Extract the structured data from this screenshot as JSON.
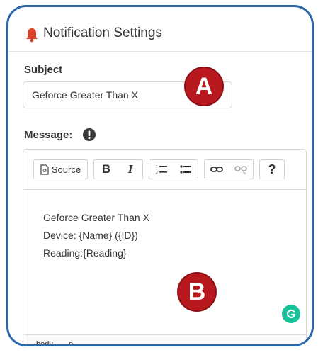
{
  "header": {
    "title": "Notification Settings",
    "icon": "bell-icon",
    "icon_color": "#d9432b"
  },
  "subject": {
    "label": "Subject",
    "value": "Geforce Greater Than X"
  },
  "message": {
    "label": "Message:",
    "info_icon": "exclamation-circle-icon"
  },
  "toolbar": {
    "source_label": "Source",
    "bold_label": "B",
    "italic_label": "I",
    "help_label": "?",
    "icons": [
      "source-icon",
      "bold-icon",
      "italic-icon",
      "numbered-list-icon",
      "bulleted-list-icon",
      "link-icon",
      "unlink-icon",
      "help-icon"
    ]
  },
  "editor": {
    "lines": [
      "Geforce Greater Than X",
      "Device: {Name} ({ID})",
      "Reading:{Reading}"
    ]
  },
  "statusbar": {
    "path": [
      "body",
      "p"
    ]
  },
  "annotations": {
    "a": "A",
    "b": "B",
    "color": "#b8191f"
  },
  "frame_color": "#2a68ad",
  "grammarly_color": "#15c39a"
}
